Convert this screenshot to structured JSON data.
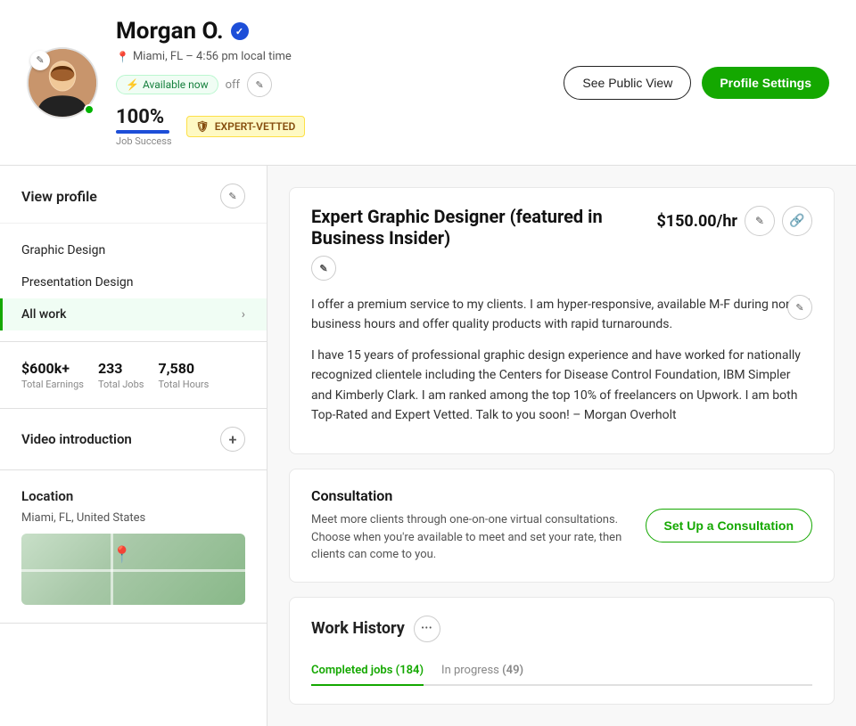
{
  "header": {
    "name": "Morgan O.",
    "location": "Miami, FL – 4:56 pm local time",
    "available_text": "Available now",
    "available_state": "off",
    "job_success_pct": "100%",
    "job_success_label": "Job Success",
    "expert_vetted_label": "EXPERT-VETTED",
    "see_public_view": "See Public View",
    "profile_settings": "Profile Settings"
  },
  "sidebar": {
    "view_profile": "View profile",
    "nav_items": [
      {
        "label": "Graphic Design",
        "active": false
      },
      {
        "label": "Presentation Design",
        "active": false
      },
      {
        "label": "All work",
        "active": true,
        "has_chevron": true
      }
    ],
    "stats": [
      {
        "value": "$600k+",
        "label": "Total Earnings"
      },
      {
        "value": "233",
        "label": "Total Jobs"
      },
      {
        "value": "7,580",
        "label": "Total Hours"
      }
    ],
    "video_intro": "Video introduction",
    "location_section": "Location",
    "location_text": "Miami, FL, United States"
  },
  "main": {
    "title": "Expert Graphic Designer (featured in Business Insider)",
    "rate": "$150.00/hr",
    "bio1": "I offer a premium service to my clients. I am hyper-responsive, available M-F during normal business hours and offer quality products with rapid turnarounds.",
    "bio2": "I have 15 years of professional graphic design experience and have worked for nationally recognized clientele including the Centers for Disease Control Foundation, IBM Simpler and Kimberly Clark. I am ranked among the top 10% of freelancers on Upwork. I am both Top-Rated and Expert Vetted. Talk to you soon! – Morgan Overholt",
    "consultation": {
      "title": "Consultation",
      "description": "Meet more clients through one-on-one virtual consultations. Choose when you're available to meet and set your rate, then clients can come to you.",
      "button": "Set Up a Consultation"
    },
    "work_history": {
      "title": "Work History",
      "tabs": [
        {
          "label": "Completed jobs",
          "count": "184",
          "active": true
        },
        {
          "label": "In progress",
          "count": "49",
          "active": false
        }
      ]
    }
  },
  "icons": {
    "edit": "✏️",
    "pencil": "✎",
    "location_pin": "📍",
    "lightning": "⚡",
    "shield": "🛡",
    "verified": "✓",
    "chevron_right": "›",
    "add": "+",
    "link": "🔗",
    "more": "•••",
    "map_pin": "📍"
  }
}
